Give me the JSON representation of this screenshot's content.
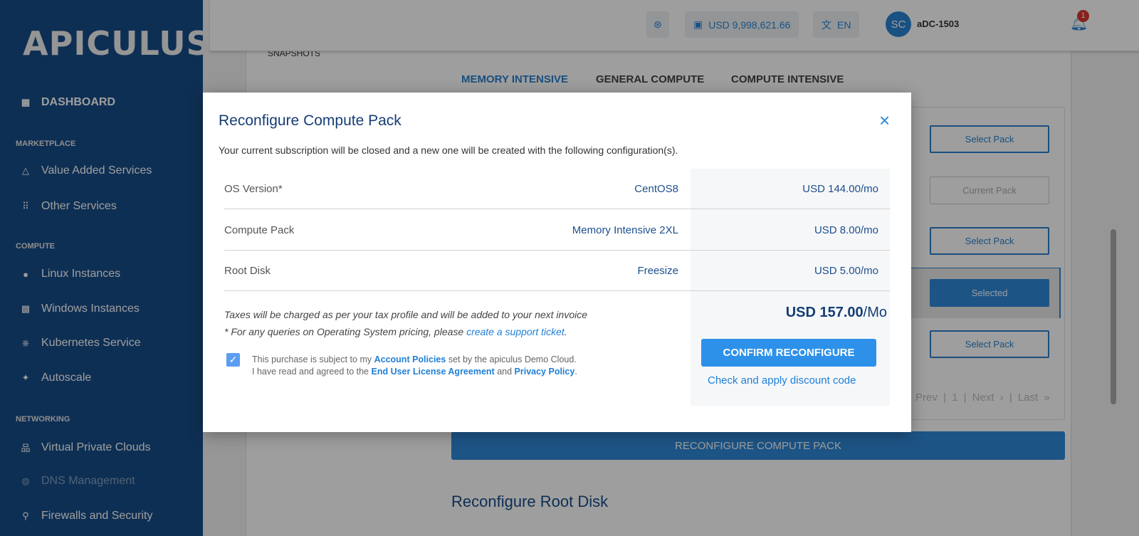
{
  "sidebar": {
    "logo": "APICULUS",
    "dashboard": "DASHBOARD",
    "sections": {
      "marketplace": "MARKETPLACE",
      "compute": "COMPUTE",
      "networking": "NETWORKING"
    },
    "items": [
      "Value Added Services",
      "Other Services",
      "Linux Instances",
      "Windows Instances",
      "Kubernetes Service",
      "Autoscale",
      "Virtual Private Clouds",
      "DNS Management",
      "Firewalls and Security"
    ]
  },
  "topbar": {
    "balance": "USD 9,998,621.66",
    "language": "EN",
    "avatar_initials": "SC",
    "username": "aDC-1503",
    "notifications": "1"
  },
  "page": {
    "snapshots": "SNAPSHOTS",
    "tabs": [
      "MEMORY INTENSIVE",
      "GENERAL COMPUTE",
      "COMPUTE INTENSIVE"
    ],
    "pack_buttons": [
      "Select Pack",
      "Current Pack",
      "Select Pack",
      "Selected",
      "Select Pack"
    ],
    "pager": {
      "prev": "Prev",
      "page": "1",
      "next": "Next ›",
      "last": "Last »"
    },
    "reconfigure_button": "RECONFIGURE COMPUTE PACK",
    "root_disk_heading": "Reconfigure Root Disk"
  },
  "modal": {
    "title": "Reconfigure Compute Pack",
    "close": "×",
    "subtitle": "Your current subscription will be closed and a new one will be created with the following configuration(s).",
    "rows": [
      {
        "label": "OS Version*",
        "value": "CentOS8",
        "price": "USD 144.00/mo"
      },
      {
        "label": "Compute Pack",
        "value": "Memory Intensive 2XL",
        "price": "USD 8.00/mo"
      },
      {
        "label": "Root Disk",
        "value": "Freesize",
        "price": "USD 5.00/mo"
      }
    ],
    "tax_note": "Taxes will be charged as per your tax profile and will be added to your next invoice",
    "os_note": "* For any queries on Operating System pricing, please ",
    "support_link": "create a support ticket",
    "agree1a": "This purchase is subject to my ",
    "account_policies": "Account Policies",
    "agree1b": " set by the apiculus Demo Cloud.",
    "agree2a": "I have read and agreed to the ",
    "eula": "End User License Agreement",
    "and": " and ",
    "privacy": "Privacy Policy",
    "agreed": true,
    "total_amount": "USD 157.00",
    "total_unit": "/Mo",
    "confirm": "CONFIRM RECONFIGURE",
    "discount": "Check and apply discount code"
  }
}
